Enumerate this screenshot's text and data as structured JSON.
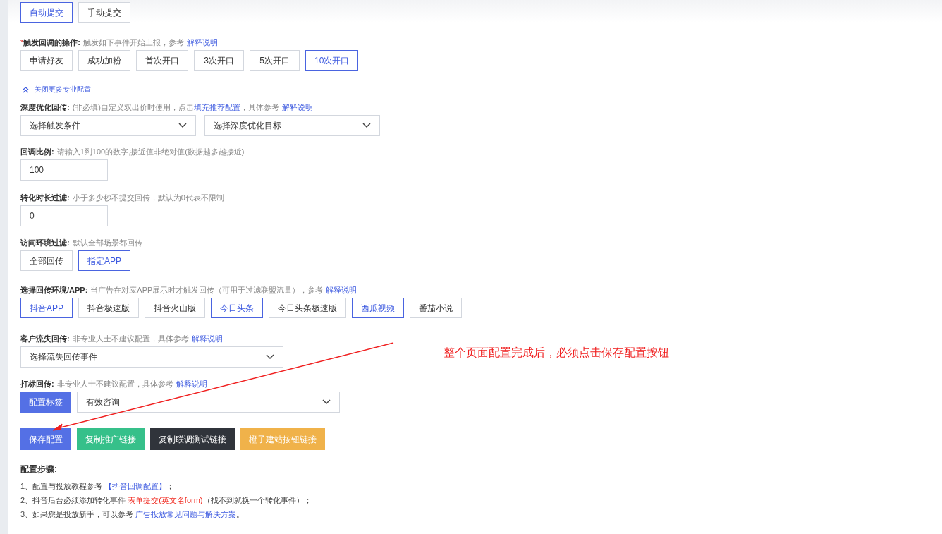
{
  "submit_mode": {
    "options": [
      {
        "label": "自动提交",
        "selected": true
      },
      {
        "label": "手动提交",
        "selected": false
      }
    ]
  },
  "trigger": {
    "required": true,
    "required_mark": "*",
    "label": "触发回调的操作:",
    "hint": "触发如下事件开始上报，参考",
    "link": "解释说明",
    "options": [
      {
        "label": "申请好友",
        "selected": false
      },
      {
        "label": "成功加粉",
        "selected": false
      },
      {
        "label": "首次开口",
        "selected": false
      },
      {
        "label": "3次开口",
        "selected": false
      },
      {
        "label": "5次开口",
        "selected": false
      },
      {
        "label": "10次开口",
        "selected": true
      }
    ]
  },
  "advanced_toggle": {
    "label": "关闭更多专业配置",
    "expanded": true
  },
  "deep_optimization": {
    "label": "深度优化回传:",
    "hint": "(非必填)自定义双出价时使用，点击",
    "inline_link": "填充推荐配置",
    "hint_after": "，具体参考",
    "link": "解释说明",
    "selects": [
      {
        "placeholder": "选择触发条件"
      },
      {
        "placeholder": "选择深度优化目标"
      }
    ]
  },
  "callback_ratio": {
    "label": "回调比例:",
    "hint": "请输入1到100的数字,接近值非绝对值(数据越多越接近)",
    "value": "100"
  },
  "duration_filter": {
    "label": "转化时长过滤:",
    "hint": "小于多少秒不提交回传，默认为0代表不限制",
    "value": "0"
  },
  "env_filter": {
    "label": "访问环境过滤:",
    "hint": "默认全部场景都回传",
    "options": [
      {
        "label": "全部回传",
        "selected": false
      },
      {
        "label": "指定APP",
        "selected": true
      }
    ]
  },
  "app_env": {
    "label": "选择回传环境/APP:",
    "hint": "当广告在对应APP展示时才触发回传（可用于过滤联盟流量），参考",
    "link": "解释说明",
    "options": [
      {
        "label": "抖音APP",
        "selected": true
      },
      {
        "label": "抖音极速版",
        "selected": false
      },
      {
        "label": "抖音火山版",
        "selected": false
      },
      {
        "label": "今日头条",
        "selected": true
      },
      {
        "label": "今日头条极速版",
        "selected": false
      },
      {
        "label": "西瓜视频",
        "selected": true
      },
      {
        "label": "番茄小说",
        "selected": false
      }
    ]
  },
  "churn": {
    "label": "客户流失回传:",
    "hint": "非专业人士不建议配置，具体参考",
    "link": "解释说明",
    "select": {
      "placeholder": "选择流失回传事件"
    }
  },
  "tagging": {
    "label": "打标回传:",
    "hint": "非专业人士不建议配置，具体参考",
    "link": "解释说明",
    "button": "配置标签",
    "select": {
      "value": "有效咨询"
    }
  },
  "actions": [
    {
      "label": "保存配置",
      "kind": "primary"
    },
    {
      "label": "复制推广链接",
      "kind": "success"
    },
    {
      "label": "复制联调测试链接",
      "kind": "dark"
    },
    {
      "label": "橙子建站按钮链接",
      "kind": "warning"
    }
  ],
  "steps": {
    "title": "配置步骤:",
    "items": [
      [
        {
          "kind": "text",
          "text": "1、配置与投放教程参考 "
        },
        {
          "kind": "link",
          "text": "【抖音回调配置】"
        },
        {
          "kind": "text",
          "text": "；"
        }
      ],
      [
        {
          "kind": "text",
          "text": "2、抖音后台必须添加转化事件 "
        },
        {
          "kind": "alert",
          "text": "表单提交(英文名form)"
        },
        {
          "kind": "text",
          "text": "（找不到就换一个转化事件）；"
        }
      ],
      [
        {
          "kind": "text",
          "text": "3、如果您是投放新手，可以参考 "
        },
        {
          "kind": "link",
          "text": "广告投放常见问题与解决方案"
        },
        {
          "kind": "text",
          "text": "。"
        }
      ]
    ]
  },
  "annotation": {
    "text": "整个页面配置完成后，必须点击保存配置按钮"
  }
}
